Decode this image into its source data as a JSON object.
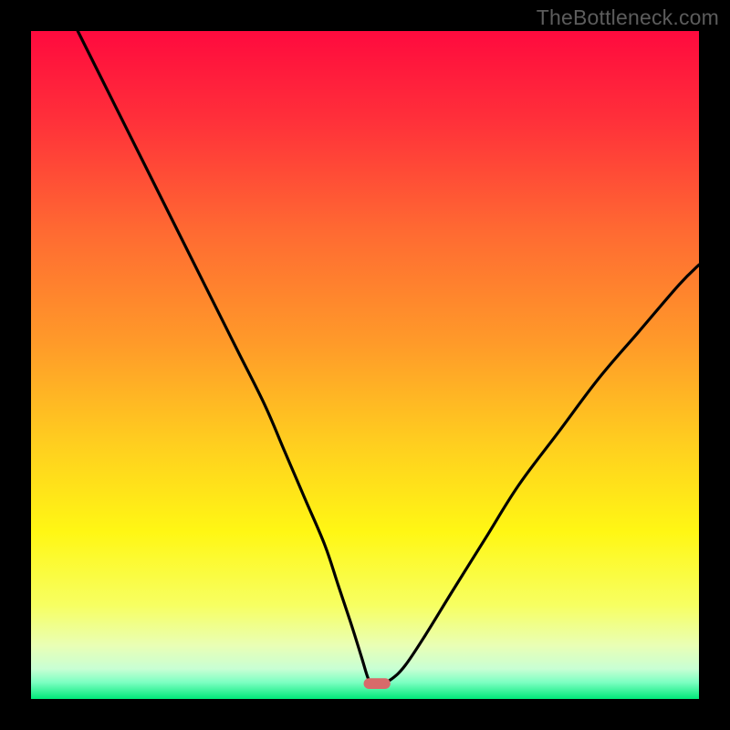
{
  "watermark": "TheBottleneck.com",
  "chart_data": {
    "type": "line",
    "title": "",
    "xlabel": "",
    "ylabel": "",
    "xlim": [
      0,
      100
    ],
    "ylim": [
      0,
      100
    ],
    "grid": false,
    "legend": false,
    "background": {
      "type": "vertical_gradient",
      "stops": [
        {
          "pos": 0.0,
          "color": "#ff0a3e"
        },
        {
          "pos": 0.13,
          "color": "#ff2f3a"
        },
        {
          "pos": 0.3,
          "color": "#ff6a32"
        },
        {
          "pos": 0.47,
          "color": "#ff9b29"
        },
        {
          "pos": 0.62,
          "color": "#ffcf1f"
        },
        {
          "pos": 0.75,
          "color": "#fff714"
        },
        {
          "pos": 0.86,
          "color": "#f7ff62"
        },
        {
          "pos": 0.92,
          "color": "#e9ffb5"
        },
        {
          "pos": 0.955,
          "color": "#c8ffd4"
        },
        {
          "pos": 0.975,
          "color": "#7dffc2"
        },
        {
          "pos": 1.0,
          "color": "#00e879"
        }
      ]
    },
    "series": [
      {
        "name": "curve",
        "x": [
          7,
          12,
          17,
          22,
          27,
          31,
          35,
          38,
          41,
          44,
          46,
          48,
          49.5,
          50.5,
          51.2,
          52.5,
          54,
          56,
          59,
          63,
          68,
          73,
          79,
          85,
          91,
          97,
          100
        ],
        "y": [
          100,
          90,
          80,
          70,
          60,
          52,
          44,
          37,
          30,
          23,
          17,
          11,
          6.2,
          3.0,
          2.3,
          2.3,
          3.0,
          5.0,
          9.5,
          16,
          24,
          32,
          40,
          48,
          55,
          62,
          65
        ]
      }
    ],
    "marker": {
      "shape": "rounded-rect",
      "cx": 51.8,
      "cy": 2.3,
      "width": 4.0,
      "height": 1.6,
      "color": "#d86a6a"
    }
  }
}
